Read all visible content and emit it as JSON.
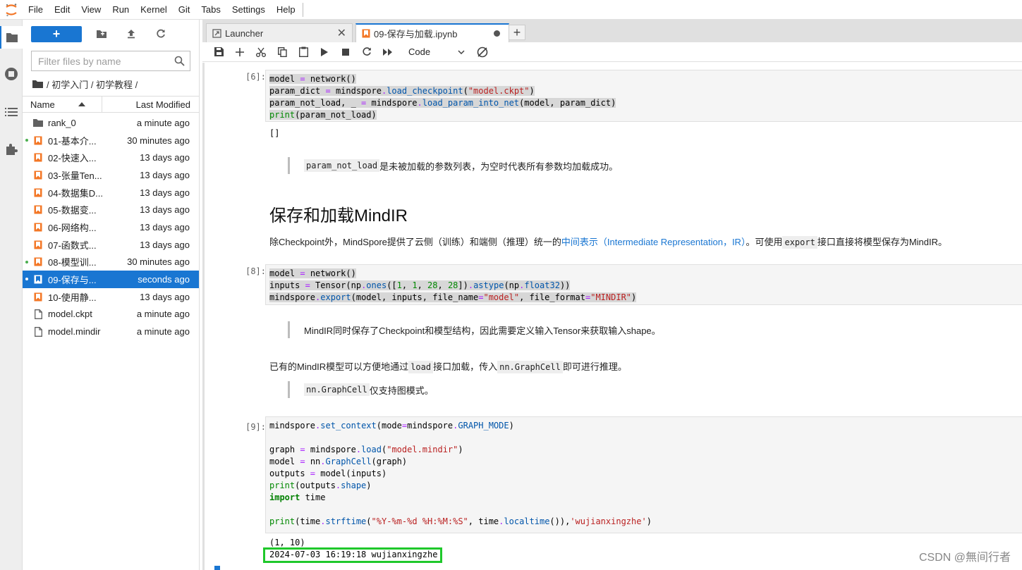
{
  "menubar": {
    "items": [
      "File",
      "Edit",
      "View",
      "Run",
      "Kernel",
      "Git",
      "Tabs",
      "Settings",
      "Help"
    ]
  },
  "sidebar": {
    "icons": [
      "folder-icon",
      "running-icon",
      "toc-icon",
      "extension-icon"
    ]
  },
  "filebrowser": {
    "new_label": "+",
    "filter_placeholder": "Filter files by name",
    "breadcrumb": "/ 初学入门 / 初学教程 /",
    "col_name": "Name",
    "col_modified": "Last Modified",
    "files": [
      {
        "name": "rank_0",
        "modified": "a minute ago",
        "type": "folder",
        "running": false
      },
      {
        "name": "01-基本介...",
        "modified": "30 minutes ago",
        "type": "notebook",
        "running": true
      },
      {
        "name": "02-快速入...",
        "modified": "13 days ago",
        "type": "notebook",
        "running": false
      },
      {
        "name": "03-张量Ten...",
        "modified": "13 days ago",
        "type": "notebook",
        "running": false
      },
      {
        "name": "04-数据集D...",
        "modified": "13 days ago",
        "type": "notebook",
        "running": false
      },
      {
        "name": "05-数据变...",
        "modified": "13 days ago",
        "type": "notebook",
        "running": false
      },
      {
        "name": "06-网络构...",
        "modified": "13 days ago",
        "type": "notebook",
        "running": false
      },
      {
        "name": "07-函数式...",
        "modified": "13 days ago",
        "type": "notebook",
        "running": false
      },
      {
        "name": "08-模型训...",
        "modified": "30 minutes ago",
        "type": "notebook",
        "running": true
      },
      {
        "name": "09-保存与...",
        "modified": "seconds ago",
        "type": "notebook",
        "running": true,
        "selected": true
      },
      {
        "name": "10-使用静...",
        "modified": "13 days ago",
        "type": "notebook",
        "running": false
      },
      {
        "name": "model.ckpt",
        "modified": "a minute ago",
        "type": "file",
        "running": false
      },
      {
        "name": "model.mindir",
        "modified": "a minute ago",
        "type": "file",
        "running": false
      }
    ]
  },
  "tabs": [
    {
      "label": "Launcher"
    },
    {
      "label": "09-保存与加载.ipynb"
    }
  ],
  "toolbar": {
    "cell_type": "Code"
  },
  "notebook": {
    "cell6_prompt": "[6]:",
    "cell6_out": "[]",
    "md1_code": "param_not_load",
    "md1_text": "是未被加载的参数列表，为空时代表所有参数均加载成功。",
    "heading": "保存和加载MindIR",
    "para1_a": "除Checkpoint外，MindSpore提供了云侧（训练）和端侧（推理）统一的",
    "para1_link": "中间表示（Intermediate Representation，IR）",
    "para1_b": "。可使用",
    "para1_code": "export",
    "para1_c": "接口直接将模型保存为MindIR。",
    "cell8_prompt": "[8]:",
    "quote2": "MindIR同时保存了Checkpoint和模型结构，因此需要定义输入Tensor来获取输入shape。",
    "para2_a": "已有的MindIR模型可以方便地通过",
    "para2_code1": "load",
    "para2_b": "接口加载，传入",
    "para2_code2": "nn.GraphCell",
    "para2_c": "即可进行推理。",
    "quote3_code": "nn.GraphCell",
    "quote3_text": "仅支持图模式。",
    "cell9_prompt": "[9]:",
    "out9_line1": "(1, 10)",
    "out9_line2": "2024-07-03 16:19:18 wujianxingzhe"
  },
  "watermark": "CSDN @無间行者"
}
